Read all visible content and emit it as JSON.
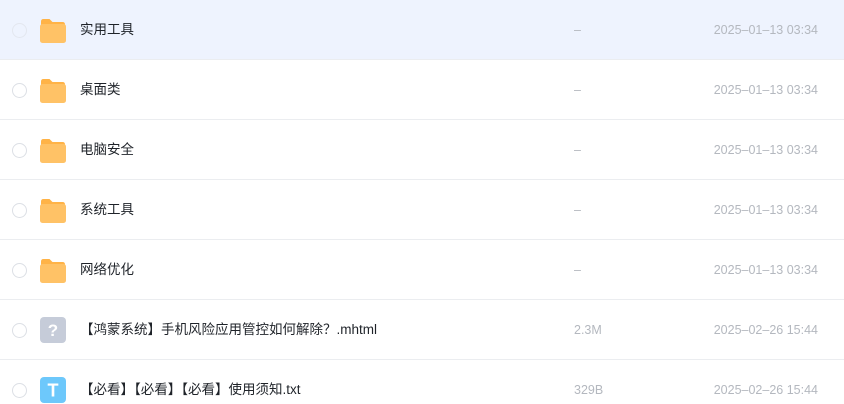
{
  "files": [
    {
      "name": "实用工具",
      "size": "–",
      "date": "2025–01–13 03:34",
      "icon": "folder-icon",
      "hovered": true
    },
    {
      "name": "桌面类",
      "size": "–",
      "date": "2025–01–13 03:34",
      "icon": "folder-icon"
    },
    {
      "name": "电脑安全",
      "size": "–",
      "date": "2025–01–13 03:34",
      "icon": "folder-icon"
    },
    {
      "name": "系统工具",
      "size": "–",
      "date": "2025–01–13 03:34",
      "icon": "folder-icon"
    },
    {
      "name": "网络优化",
      "size": "–",
      "date": "2025–01–13 03:34",
      "icon": "folder-icon"
    },
    {
      "name": "【鸿蒙系统】手机风险应用管控如何解除？.mhtml",
      "size": "2.3M",
      "date": "2025–02–26 15:44",
      "icon": "unknown-file-icon",
      "glyph": "?"
    },
    {
      "name": "【必看】【必看】【必看】使用须知.txt",
      "size": "329B",
      "date": "2025–02–26 15:44",
      "icon": "text-file-icon",
      "glyph": "T"
    }
  ],
  "colors": {
    "folder": "#ffc266",
    "folder_back": "#ffb347",
    "unknown_file": "#c6ccd9",
    "text_file": "#6dc8fb",
    "hover_bg": "#eef3fe",
    "muted_text": "#b4b8bf"
  }
}
